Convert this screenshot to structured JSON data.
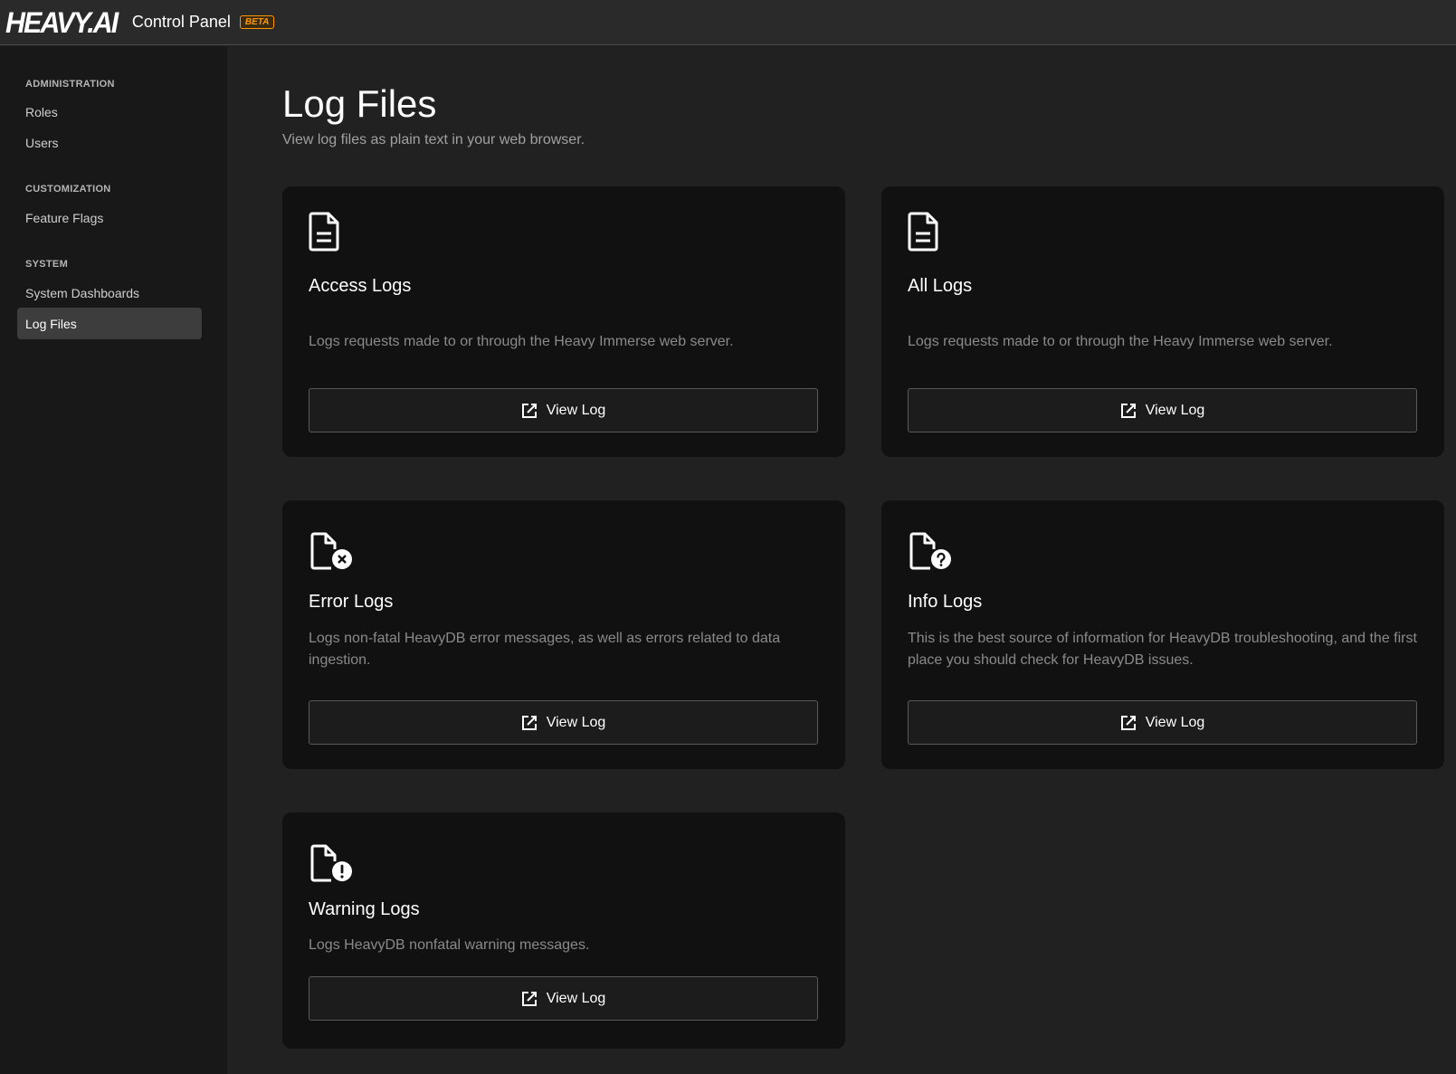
{
  "header": {
    "logo": "HEAVY.AI",
    "title": "Control Panel",
    "badge": "BETA"
  },
  "sidebar": {
    "sections": [
      {
        "label": "ADMINISTRATION",
        "items": [
          {
            "label": "Roles"
          },
          {
            "label": "Users"
          }
        ]
      },
      {
        "label": "CUSTOMIZATION",
        "items": [
          {
            "label": "Feature Flags"
          }
        ]
      },
      {
        "label": "SYSTEM",
        "items": [
          {
            "label": "System Dashboards"
          },
          {
            "label": "Log Files",
            "active": true
          }
        ]
      }
    ]
  },
  "page": {
    "title": "Log Files",
    "subtitle": "View log files as plain text in your web browser."
  },
  "cards": [
    {
      "icon": "file-text-icon",
      "title": "Access Logs",
      "description": "Logs requests made to or through the Heavy Immerse web server.",
      "button": "View Log"
    },
    {
      "icon": "file-text-icon",
      "title": "All Logs",
      "description": "Logs requests made to or through the Heavy Immerse web server.",
      "button": "View Log"
    },
    {
      "icon": "file-error-icon",
      "title": "Error Logs",
      "description": "Logs non-fatal HeavyDB error messages, as well as errors related to data ingestion.",
      "button": "View Log"
    },
    {
      "icon": "file-question-icon",
      "title": "Info Logs",
      "description": "This is the best source of information for HeavyDB troubleshooting, and the first place you should check for HeavyDB issues.",
      "button": "View Log"
    },
    {
      "icon": "file-warning-icon",
      "title": "Warning Logs",
      "description": "Logs HeavyDB nonfatal warning messages.",
      "button": "View Log"
    }
  ],
  "colors": {
    "background": "#212121",
    "sidebar": "#181818",
    "card": "#111111",
    "accent": "#ff9800"
  }
}
